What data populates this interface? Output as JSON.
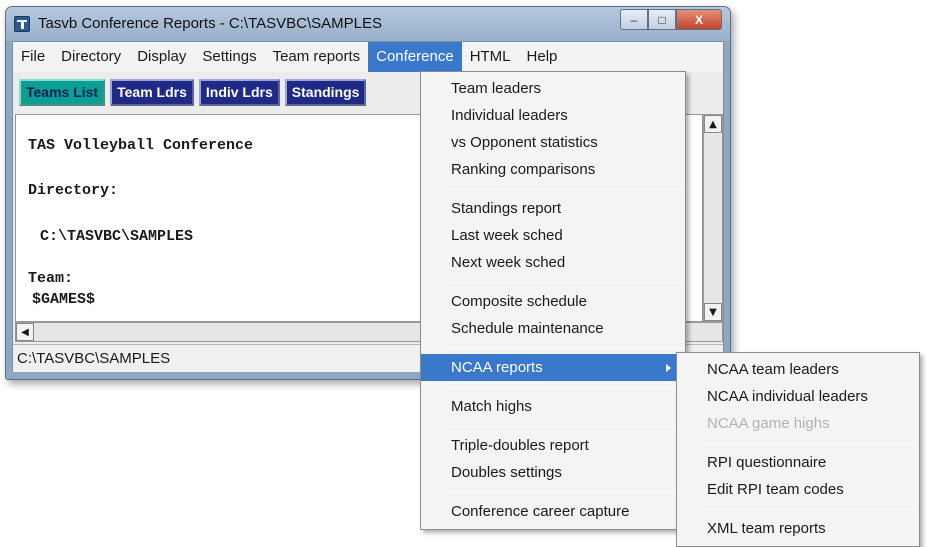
{
  "window": {
    "title": "Tasvb Conference Reports - C:\\TASVBC\\SAMPLES",
    "controls": {
      "minimize": "–",
      "maximize": "□",
      "close": "X"
    }
  },
  "menubar": [
    "File",
    "Directory",
    "Display",
    "Settings",
    "Team reports",
    "Conference",
    "HTML",
    "Help"
  ],
  "active_menu": "Conference",
  "toolbar": [
    "Teams List",
    "Team Ldrs",
    "Indiv Ldrs",
    "Standings"
  ],
  "content": {
    "heading": "TAS Volleyball Conference",
    "directory_label": "Directory:",
    "directory_value": "C:\\TASVBC\\SAMPLES",
    "team_label": "Team:",
    "team_value": "$GAMES$"
  },
  "statusbar": "C:\\TASVBC\\SAMPLES",
  "conference_menu": {
    "group1": [
      "Team leaders",
      "Individual leaders",
      "vs Opponent statistics",
      "Ranking comparisons"
    ],
    "group2": [
      "Standings report",
      "Last week sched",
      "Next week sched"
    ],
    "group3": [
      "Composite schedule",
      "Schedule maintenance"
    ],
    "group4": [
      "NCAA reports"
    ],
    "group5": [
      "Match highs"
    ],
    "group6": [
      "Triple-doubles report",
      "Doubles settings"
    ],
    "group7": [
      "Conference career capture"
    ]
  },
  "ncaa_submenu": {
    "group1": [
      "NCAA team leaders",
      "NCAA individual leaders",
      "NCAA game highs"
    ],
    "group2": [
      "RPI questionnaire",
      "Edit RPI team codes"
    ],
    "group3": [
      "XML team reports"
    ],
    "disabled": [
      "NCAA game highs"
    ]
  },
  "colors": {
    "menu_highlight": "#3a78cc",
    "toolbar_button": "#1f2a86",
    "toolbar_button_active": "#0c9e90",
    "title_bar": "#a7bdd6"
  }
}
